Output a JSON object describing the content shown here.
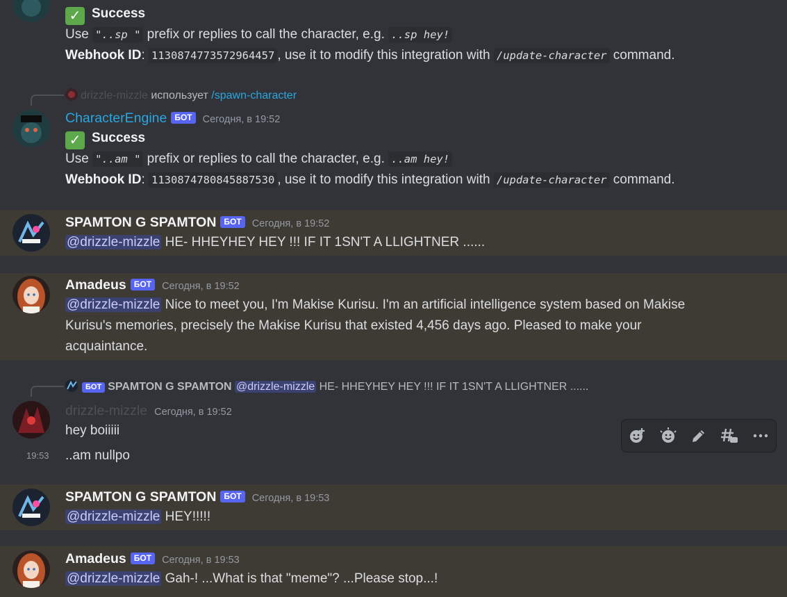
{
  "messages_top": {
    "success_label": "Success",
    "check_glyph": "✓",
    "line1": {
      "a": "Use ",
      "code1": "\"..sp \"",
      "b": " prefix or replies to call the character, e.g. ",
      "code2": "..sp hey!"
    },
    "line2": {
      "label": "Webhook ID",
      "colon": ": ",
      "id": "1130874773572964457",
      "b": ", use it to modify this integration with ",
      "cmd": "/update-character",
      "c": " command."
    }
  },
  "msg_ce": {
    "reply": {
      "user": "drizzle-mizzle",
      "verb": " использует ",
      "cmd": "/spawn-character"
    },
    "author": "CharacterEngine",
    "bot_tag": "БОТ",
    "timestamp": "Сегодня, в 19:52",
    "success_label": "Success",
    "check_glyph": "✓",
    "line1": {
      "a": "Use ",
      "code1": "\"..am \"",
      "b": " prefix or replies to call the character, e.g. ",
      "code2": "..am hey!"
    },
    "line2": {
      "label": "Webhook ID",
      "colon": ": ",
      "id": "1130874780845887530",
      "b": ", use it to modify this integration with ",
      "cmd": "/update-character",
      "c": " command."
    }
  },
  "msg_sp1": {
    "author": "SPAMTON G SPAMTON",
    "bot_tag": "БОТ",
    "timestamp": "Сегодня, в 19:52",
    "mention": "@drizzle-mizzle",
    "text": " HE- HHEYHEY HEY !!! IF IT 1SN'T A LLIGHTNER ......"
  },
  "msg_am1": {
    "author": "Amadeus",
    "bot_tag": "БОТ",
    "timestamp": "Сегодня, в 19:52",
    "mention": "@drizzle-mizzle",
    "text": " Nice to meet you, I'm Makise Kurisu. I'm an artificial intelligence system based on Makise Kurisu's memories, precisely the Makise Kurisu that existed 4,456 days ago. Pleased to make your acquaintance."
  },
  "msg_dm": {
    "reply": {
      "bot_tag": "БОТ",
      "user": "SPAMTON G SPAMTON",
      "mention": "@drizzle-mizzle",
      "text": " HE- HHEYHEY HEY !!! IF IT 1SN'T A LLIGHTNER ......"
    },
    "author": "drizzle-mizzle",
    "timestamp": "Сегодня, в 19:52",
    "text1": "hey boiiiii",
    "side_timestamp": "19:53",
    "text2": "..am nullpo"
  },
  "msg_sp2": {
    "author": "SPAMTON G SPAMTON",
    "bot_tag": "БОТ",
    "timestamp": "Сегодня, в 19:53",
    "mention": "@drizzle-mizzle",
    "text": " HEY!!!!!"
  },
  "msg_am2": {
    "author": "Amadeus",
    "bot_tag": "БОТ",
    "timestamp": "Сегодня, в 19:53",
    "mention": "@drizzle-mizzle",
    "text": " Gah-! ...What is that \"meme\"? ...Please stop...!"
  },
  "toolbar": {
    "icons": [
      "add-reaction-icon",
      "super-reaction-icon",
      "edit-icon",
      "create-thread-icon",
      "more-icon"
    ]
  },
  "colors": {
    "background": "#313338",
    "highlight": "#3e3a34",
    "bot_badge": "#5865f2",
    "mention_bg": "#3c4270",
    "link": "#2aa6e0",
    "success": "#5ca84a"
  }
}
